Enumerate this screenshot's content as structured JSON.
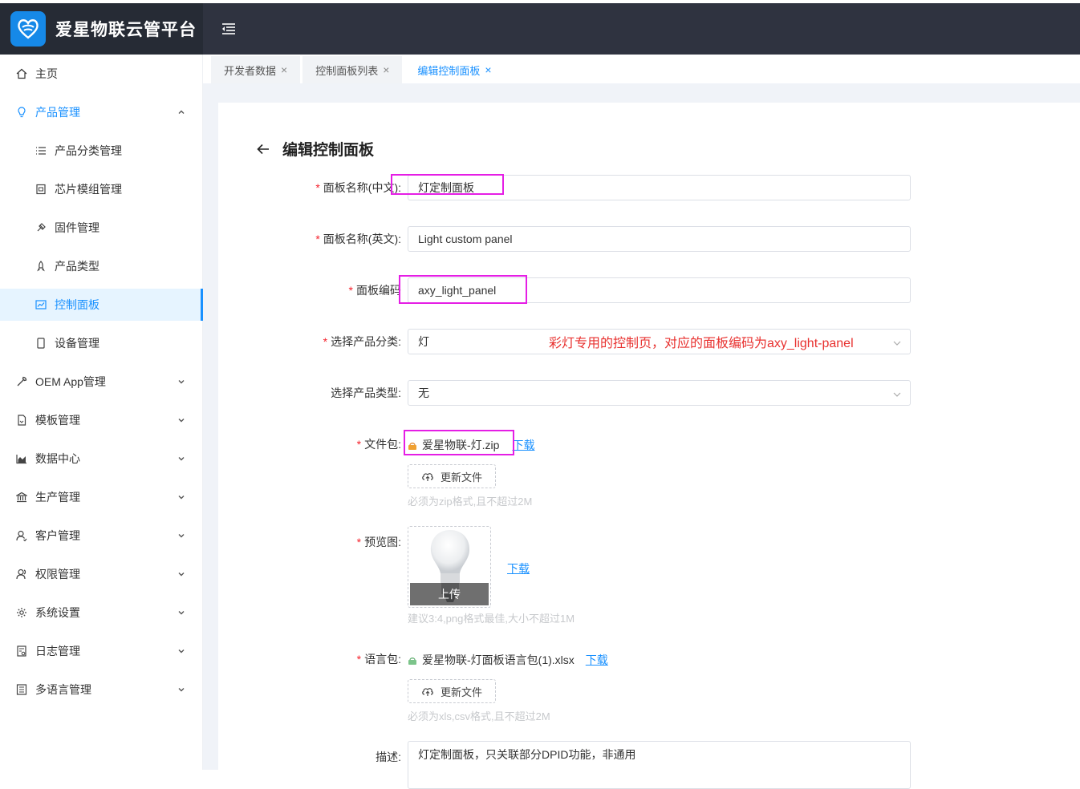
{
  "app": {
    "title": "爱星物联云管平台"
  },
  "sidebar": {
    "items": [
      {
        "label": "主页",
        "icon": "home-icon"
      },
      {
        "label": "产品管理",
        "icon": "bulb-icon",
        "expanded": true
      },
      {
        "label": "产品分类管理",
        "icon": "list-icon"
      },
      {
        "label": "芯片模组管理",
        "icon": "chip-icon"
      },
      {
        "label": "固件管理",
        "icon": "firmware-icon"
      },
      {
        "label": "产品类型",
        "icon": "rocket-icon"
      },
      {
        "label": "控制面板",
        "icon": "chart-icon",
        "active": true
      },
      {
        "label": "设备管理",
        "icon": "device-icon"
      },
      {
        "label": "OEM App管理",
        "icon": "wrench-icon"
      },
      {
        "label": "模板管理",
        "icon": "template-icon"
      },
      {
        "label": "数据中心",
        "icon": "area-chart-icon"
      },
      {
        "label": "生产管理",
        "icon": "bank-icon"
      },
      {
        "label": "客户管理",
        "icon": "user-icon"
      },
      {
        "label": "权限管理",
        "icon": "users-icon"
      },
      {
        "label": "系统设置",
        "icon": "gear-icon"
      },
      {
        "label": "日志管理",
        "icon": "log-icon"
      },
      {
        "label": "多语言管理",
        "icon": "language-icon"
      }
    ]
  },
  "tabs": [
    {
      "label": "开发者数据"
    },
    {
      "label": "控制面板列表"
    },
    {
      "label": "编辑控制面板",
      "active": true
    }
  ],
  "page": {
    "title": "编辑控制面板"
  },
  "form": {
    "name_cn": {
      "label": "面板名称(中文):",
      "value": "灯定制面板"
    },
    "name_en": {
      "label": "面板名称(英文):",
      "value": "Light custom panel"
    },
    "code": {
      "label": "面板编码",
      "value": "axy_light_panel"
    },
    "category": {
      "label": "选择产品分类:",
      "value": "灯"
    },
    "type": {
      "label": "选择产品类型:",
      "value": "无"
    },
    "file_pkg": {
      "label": "文件包:",
      "file_name": "爱星物联-灯.zip",
      "download": "下载",
      "update_btn": "更新文件",
      "hint": "必须为zip格式,且不超过2M"
    },
    "preview": {
      "label": "预览图:",
      "upload": "上传",
      "download": "下载",
      "hint": "建议3:4,png格式最佳,大小不超过1M"
    },
    "lang_pkg": {
      "label": "语言包:",
      "file_name": "爱星物联-灯面板语言包(1).xlsx",
      "download": "下载",
      "update_btn": "更新文件",
      "hint": "必须为xls,csv格式,且不超过2M"
    },
    "desc": {
      "label": "描述:",
      "value": "灯定制面板，只关联部分DPID功能，非通用"
    }
  },
  "annotation": {
    "text": "彩灯专用的控制页，对应的面板编码为axy_light-panel",
    "color": "#e8312f"
  },
  "colors": {
    "accent": "#1890ff",
    "header": "#2f3340",
    "highlight": "#e51ee5",
    "required": "#f5222d"
  }
}
